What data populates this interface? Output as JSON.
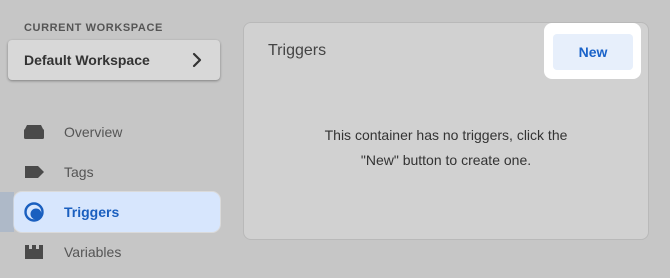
{
  "workspace": {
    "section_label": "CURRENT WORKSPACE",
    "name": "Default Workspace"
  },
  "nav": {
    "items": [
      {
        "label": "Overview",
        "icon": "overview-icon"
      },
      {
        "label": "Tags",
        "icon": "tag-icon"
      },
      {
        "label": "Triggers",
        "icon": "trigger-icon",
        "active": true
      },
      {
        "label": "Variables",
        "icon": "variables-icon"
      }
    ]
  },
  "main": {
    "title": "Triggers",
    "new_button_label": "New",
    "empty_message_line1": "This container has no triggers, click the",
    "empty_message_line2": "\"New\" button to create one."
  },
  "colors": {
    "background": "#c6c6c6",
    "active_nav_bg": "#d7e6fd",
    "active_nav_text": "#1a5fbf",
    "new_button_text": "#1a63c9",
    "new_button_bg": "#e7effb"
  }
}
